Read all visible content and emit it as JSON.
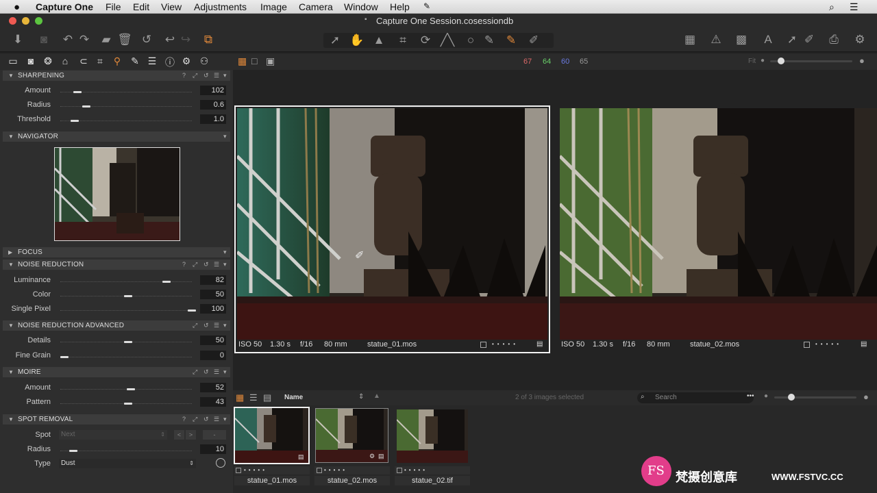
{
  "menubar": {
    "app_name": "Capture One",
    "items": [
      "File",
      "Edit",
      "View",
      "Adjustments",
      "Image",
      "Camera",
      "Window",
      "Help"
    ]
  },
  "window": {
    "title": "Capture One Session.cosessiondb"
  },
  "viewer_bar": {
    "readings": [
      "67",
      "64",
      "60",
      "65"
    ],
    "reading_colors": [
      "#e06a6a",
      "#6ad06a",
      "#6a7ae0",
      "#999999"
    ],
    "zoom_label": "Fit"
  },
  "panels": {
    "sharpening": {
      "title": "SHARPENING",
      "rows": [
        {
          "label": "Amount",
          "value": "102",
          "level": 0.1
        },
        {
          "label": "Radius",
          "value": "0.6",
          "level": 0.17
        },
        {
          "label": "Threshold",
          "value": "1.0",
          "level": 0.08
        }
      ]
    },
    "navigator": {
      "title": "NAVIGATOR"
    },
    "focus": {
      "title": "FOCUS"
    },
    "noise_reduction": {
      "title": "NOISE REDUCTION",
      "rows": [
        {
          "label": "Luminance",
          "value": "82",
          "level": 0.8
        },
        {
          "label": "Color",
          "value": "50",
          "level": 0.5
        },
        {
          "label": "Single Pixel",
          "value": "100",
          "level": 1.0
        }
      ]
    },
    "noise_reduction_advanced": {
      "title": "NOISE REDUCTION ADVANCED",
      "rows": [
        {
          "label": "Details",
          "value": "50",
          "level": 0.5
        },
        {
          "label": "Fine Grain",
          "value": "0",
          "level": 0.0
        }
      ]
    },
    "moire": {
      "title": "MOIRE",
      "rows": [
        {
          "label": "Amount",
          "value": "52",
          "level": 0.52
        },
        {
          "label": "Pattern",
          "value": "43",
          "level": 0.5
        }
      ]
    },
    "spot_removal": {
      "title": "SPOT REMOVAL",
      "spot_label": "Spot",
      "spot_next": "Next",
      "radius_label": "Radius",
      "radius_value": "10",
      "radius_level": 0.07,
      "type_label": "Type",
      "type_value": "Dust"
    }
  },
  "viewer": {
    "images": [
      {
        "iso": "ISO 50",
        "shutter": "1.30 s",
        "aperture": "f/16",
        "focal": "80 mm",
        "filename": "statue_01.mos",
        "selected": true
      },
      {
        "iso": "ISO 50",
        "shutter": "1.30 s",
        "aperture": "f/16",
        "focal": "80 mm",
        "filename": "statue_02.mos",
        "selected": false
      }
    ]
  },
  "browser": {
    "sort_label": "Name",
    "selection_status": "2 of 3 images selected",
    "search_placeholder": "Search",
    "thumbnails": [
      {
        "filename": "statue_01.mos"
      },
      {
        "filename": "statue_02.mos"
      },
      {
        "filename": "statue_02.tif"
      }
    ]
  },
  "watermark": {
    "logo_text": "FS",
    "site_text": "梵摄创意库",
    "url": "WWW.FSTVC.CC"
  }
}
